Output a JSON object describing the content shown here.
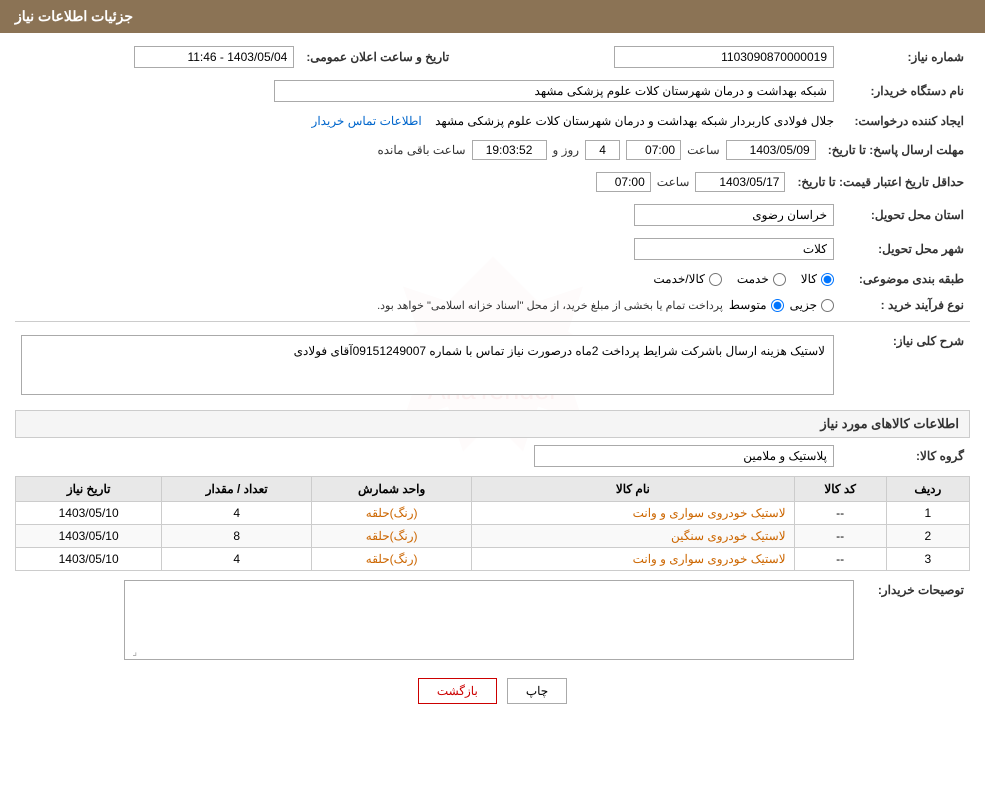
{
  "header": {
    "title": "جزئیات اطلاعات نیاز"
  },
  "fields": {
    "shomare_niaz_label": "شماره نیاز:",
    "shomare_niaz_value": "1103090870000019",
    "tarikh_label": "تاریخ و ساعت اعلان عمومی:",
    "tarikh_value": "1403/05/04 - 11:46",
    "name_dastgah_label": "نام دستگاه خریدار:",
    "name_dastgah_value": "شبکه بهداشت و درمان شهرستان کلات   علوم پزشکی مشهد",
    "creator_label": "ایجاد کننده درخواست:",
    "creator_value": "جلال فولادی کاربردار شبکه بهداشت و درمان شهرستان کلات   علوم پزشکی مشهد",
    "contact_link": "اطلاعات تماس خریدار",
    "mohlat_label": "مهلت ارسال پاسخ: تا تاریخ:",
    "mohlat_date": "1403/05/09",
    "mohlat_saat_label": "ساعت",
    "mohlat_saat": "07:00",
    "mohlat_roz_label": "روز و",
    "mohlat_roz": "4",
    "mohlat_remaining_label": "ساعت باقی مانده",
    "mohlat_remaining": "19:03:52",
    "hedaqal_label": "حداقل تاریخ اعتبار قیمت: تا تاریخ:",
    "hedaqal_date": "1403/05/17",
    "hedaqal_saat_label": "ساعت",
    "hedaqal_saat": "07:00",
    "ostan_label": "استان محل تحویل:",
    "ostan_value": "خراسان رضوی",
    "shahr_label": "شهر محل تحویل:",
    "shahr_value": "کلات",
    "tabaqe_label": "طبقه بندی موضوعی:",
    "tabaqe_kala": "کالا",
    "tabaqe_khadamat": "خدمت",
    "tabaqe_kala_khadamat": "کالا/خدمت",
    "selected_tabaqe": "kala",
    "nooe_farayand_label": "نوع فرآیند خرید :",
    "nooe_farayand_jozii": "جزیی",
    "nooe_farayand_mota_wassat": "متوسط",
    "nooe_farayand_selected": "mota_wassat",
    "nooe_farayand_note": "پرداخت تمام یا بخشی از مبلغ خرید، از محل \"اسناد خزانه اسلامی\" خواهد بود.",
    "sharh_label": "شرح کلی نیاز:",
    "sharh_value": "لاستیک هزینه ارسال باشرکت شرایط پرداخت 2ماه درصورت نیاز تماس با شماره 09151249007آقای فولادی",
    "kala_group_label": "گروه کالا:",
    "kala_group_value": "پلاستیک و ملامین",
    "table_headers": {
      "radif": "ردیف",
      "kod_kala": "کد کالا",
      "name_kala": "نام کالا",
      "vahed": "واحد شمارش",
      "tedad": "تعداد / مقدار",
      "tarikh_niaz": "تاریخ نیاز"
    },
    "table_rows": [
      {
        "radif": "1",
        "kod_kala": "--",
        "name_kala": "لاستیک خودروی سواری و وانت",
        "vahed": "(رنگ)حلقه",
        "tedad": "4",
        "tarikh_niaz": "1403/05/10"
      },
      {
        "radif": "2",
        "kod_kala": "--",
        "name_kala": "لاستیک خودروی سنگین",
        "vahed": "(رنگ)حلقه",
        "tedad": "8",
        "tarikh_niaz": "1403/05/10"
      },
      {
        "radif": "3",
        "kod_kala": "--",
        "name_kala": "لاستیک خودروی سواری و وانت",
        "vahed": "(رنگ)حلقه",
        "tedad": "4",
        "tarikh_niaz": "1403/05/10"
      }
    ],
    "tosihaat_label": "توصیحات خریدار:",
    "btn_print": "چاپ",
    "btn_back": "بازگشت"
  }
}
